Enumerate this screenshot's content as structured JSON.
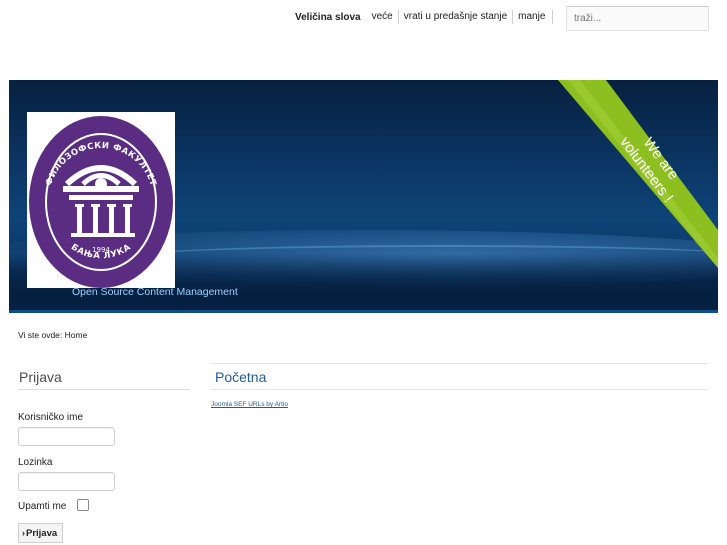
{
  "font_size": {
    "title": "Veličina slova",
    "links": [
      "veće",
      "vrati u predašnje stanje",
      "manje"
    ]
  },
  "search": {
    "placeholder": "traži..."
  },
  "header": {
    "logo_text_top": "ФИЛОЗОФСКИ ФАКУЛТЕТ",
    "logo_text_bottom": "БАЊА ЛУКА",
    "logo_year": "1994",
    "tagline": "Open Source Content Management",
    "ribbon_line1": "We are",
    "ribbon_line2": "volunteers !"
  },
  "breadcrumb": {
    "text": "Vi ste ovde: Home"
  },
  "login": {
    "title": "Prijava",
    "username_label": "Korisničko ime",
    "password_label": "Lozinka",
    "remember_label": "Upamti me",
    "submit_label": "Prijava",
    "submit_arrow": "›"
  },
  "main": {
    "title": "Početna",
    "link_text": "Joomla SEF URLs by Artio"
  },
  "colors": {
    "header_dark": "#07203f",
    "header_mid": "#0e4478",
    "ribbon": "#8cbf1f",
    "logo_purple": "#5a2d82",
    "link_blue": "#1f5d96"
  }
}
